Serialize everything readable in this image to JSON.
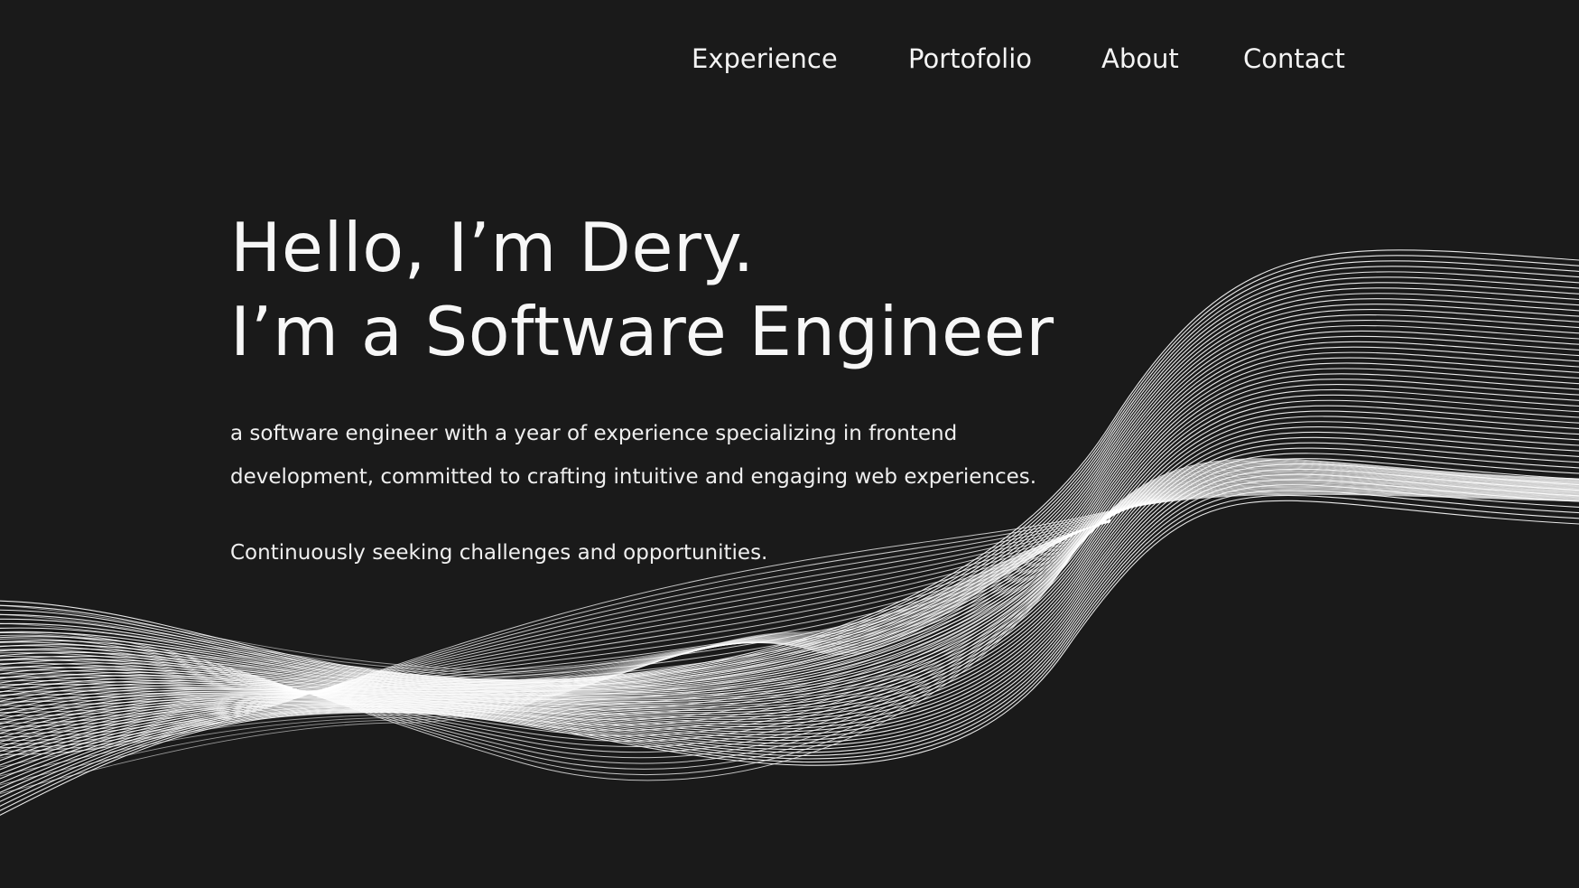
{
  "nav": {
    "items": [
      {
        "label": "Experience"
      },
      {
        "label": "Portofolio"
      },
      {
        "label": "About"
      },
      {
        "label": "Contact"
      }
    ]
  },
  "hero": {
    "title_line1": "Hello, I’m Dery.",
    "title_line2": "I’m a Software Engineer",
    "description_line1": "a software engineer with a year of experience specializing in frontend",
    "description_line2": "development, committed to crafting intuitive and engaging web experiences.",
    "tagline": "Continuously seeking challenges and opportunities."
  },
  "colors": {
    "background": "#1a1a1a",
    "text": "#f4f4f4",
    "wave_lines": "#ffffff"
  },
  "decoration": {
    "background_graphic": "white-wave-lines"
  }
}
